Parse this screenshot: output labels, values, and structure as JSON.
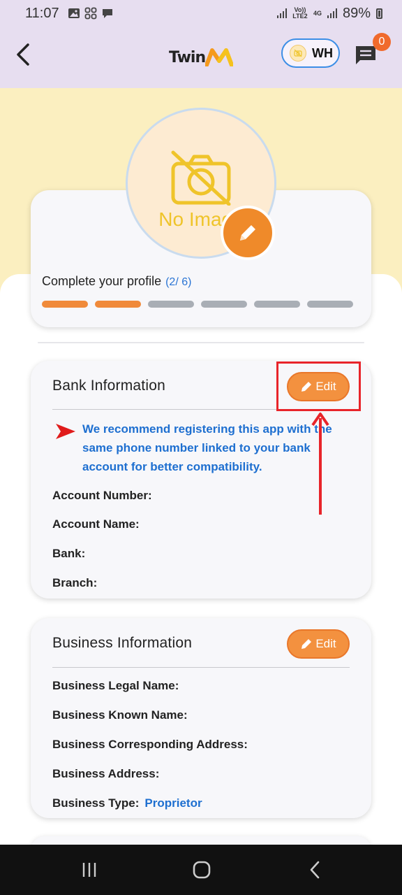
{
  "status_bar": {
    "time": "11:07",
    "network_tech": "4G",
    "volte": "Vo)) LTE2",
    "battery": "89%"
  },
  "header": {
    "logo_text": "Twin",
    "store_initials": "WH",
    "chat_badge_count": "0"
  },
  "profile": {
    "avatar_placeholder": "No Image",
    "complete_title": "Complete your profile",
    "complete_count": "(2/ 6)",
    "progress_completed": 2,
    "progress_total": 6
  },
  "bank": {
    "title": "Bank Information",
    "edit_label": "Edit",
    "notice": "We recommend registering this app with the same phone number linked to your bank account for better compatibility.",
    "fields": [
      {
        "label": "Account Number:",
        "value": ""
      },
      {
        "label": "Account Name:",
        "value": ""
      },
      {
        "label": "Bank:",
        "value": ""
      },
      {
        "label": "Branch:",
        "value": ""
      }
    ]
  },
  "business": {
    "title": "Business Information",
    "edit_label": "Edit",
    "fields": [
      {
        "label": "Business Legal Name:",
        "value": ""
      },
      {
        "label": "Business Known Name:",
        "value": ""
      },
      {
        "label": "Business Corresponding Address:",
        "value": ""
      },
      {
        "label": "Business Address:",
        "value": ""
      },
      {
        "label": "Business Type:",
        "value": "Proprietor"
      }
    ]
  },
  "colors": {
    "accent": "#f3913f",
    "link_blue": "#1e6fd0",
    "header_bg": "#e7def0",
    "hero_bg": "#fbefc0",
    "annotation_red": "#e8242a"
  }
}
